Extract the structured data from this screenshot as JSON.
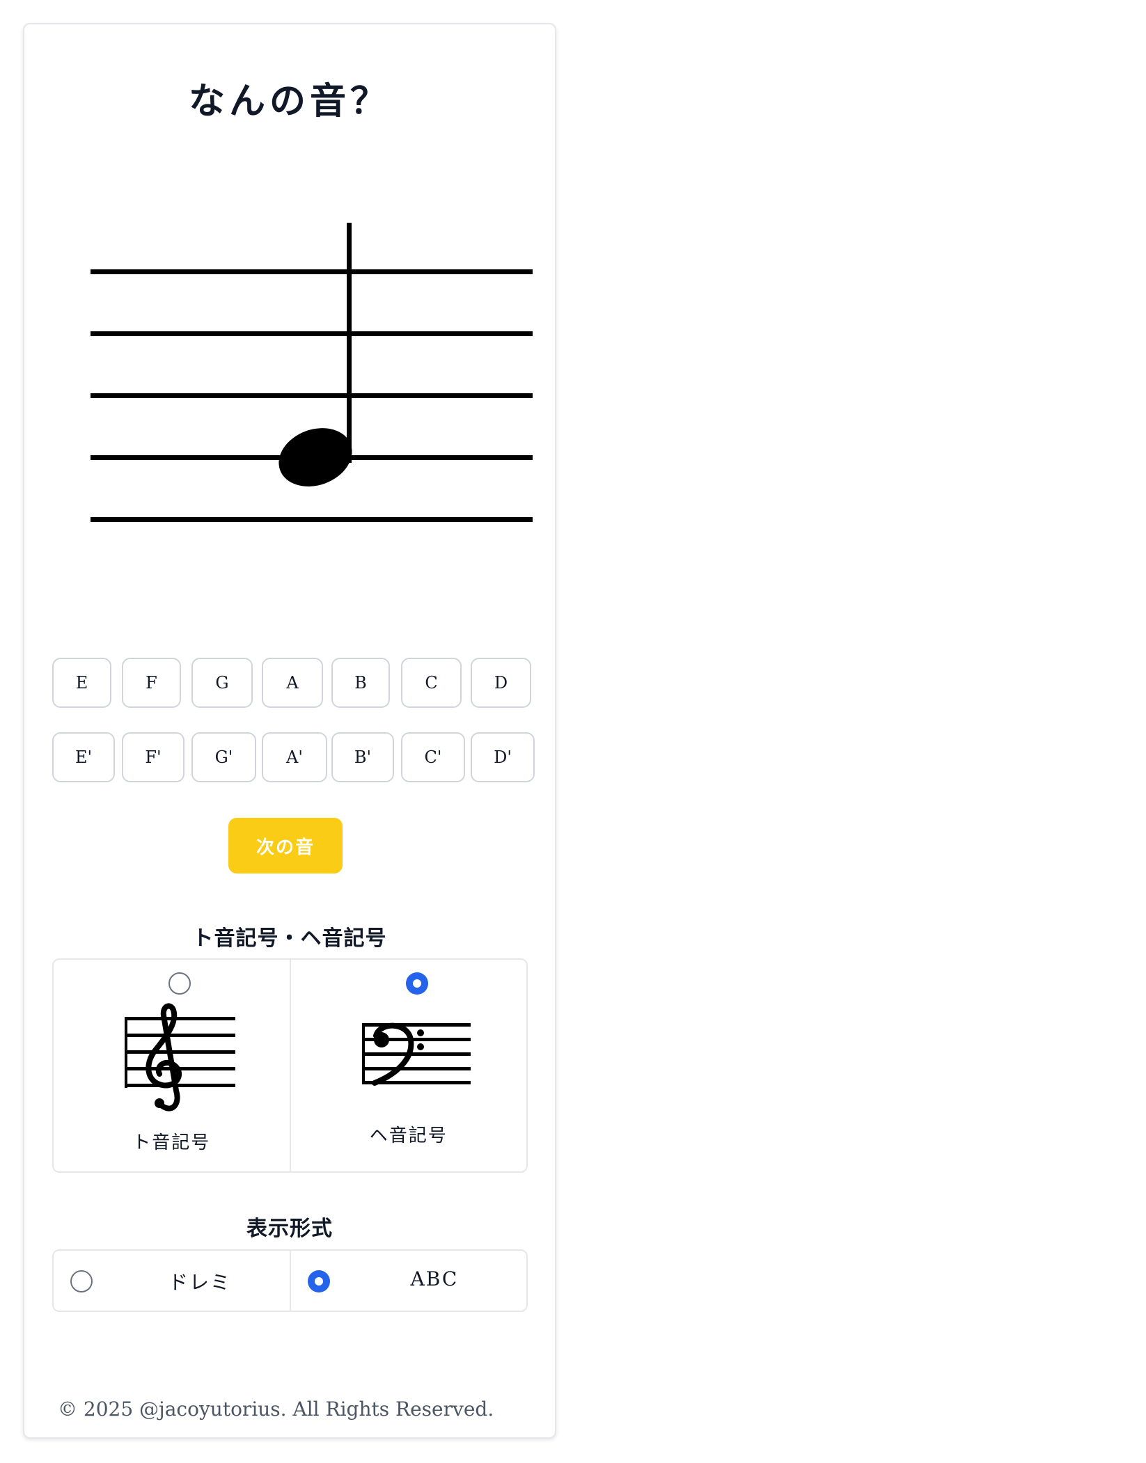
{
  "title": "なんの音？",
  "note_buttons_row1": [
    "E",
    "F",
    "G",
    "A",
    "B",
    "C",
    "D"
  ],
  "note_buttons_row2": [
    "E'",
    "F'",
    "G'",
    "A'",
    "B'",
    "C'",
    "D'"
  ],
  "next_button": "次の音",
  "clef_section": {
    "heading": "ト音記号・ヘ音記号",
    "options": [
      {
        "label": "ト音記号",
        "icon": "treble-clef-icon",
        "selected": false
      },
      {
        "label": "ヘ音記号",
        "icon": "bass-clef-icon",
        "selected": true
      }
    ]
  },
  "format_section": {
    "heading": "表示形式",
    "options": [
      {
        "label": "ドレミ",
        "selected": false
      },
      {
        "label": "ABC",
        "selected": true
      }
    ]
  },
  "footer": "© 2025 @jacoyutorius. All Rights Reserved.",
  "colors": {
    "accent_yellow": "#facc15",
    "radio_blue": "#2563eb",
    "border": "#e5e7eb"
  }
}
